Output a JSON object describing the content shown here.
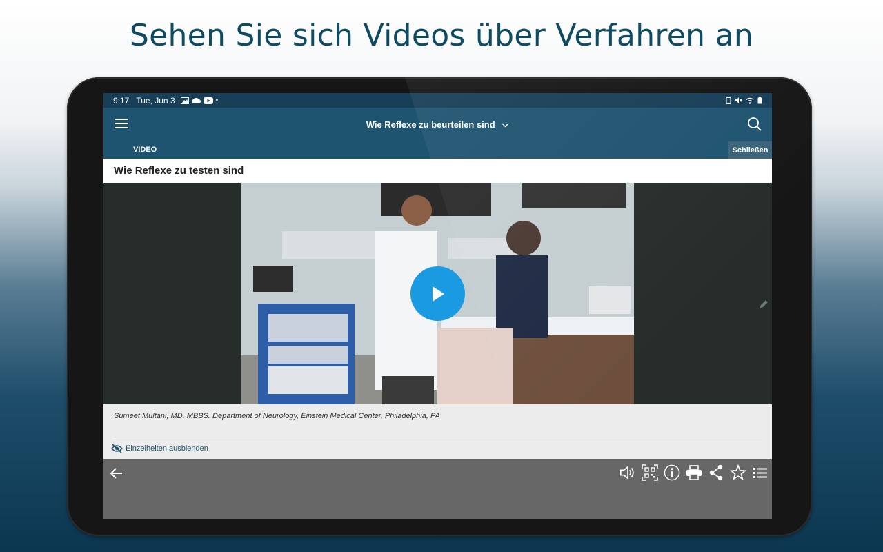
{
  "headline": "Sehen Sie sich Videos über Verfahren an",
  "status": {
    "time": "9:17",
    "date": "Tue, Jun 3"
  },
  "appbar": {
    "title": "Wie Reflexe zu beurteilen sind"
  },
  "subbar": {
    "label": "VIDEO",
    "close_label": "Schließen"
  },
  "video": {
    "title": "Wie Reflexe zu testen sind",
    "caption": "Sumeet Multani, MD, MBBS. Department of Neurology, Einstein Medical Center, Philadelphia, PA",
    "hide_details_label": "Einzelheiten ausblenden"
  },
  "icons": {
    "menu": "hamburger-icon",
    "search": "search-icon",
    "dropdown": "chevron-down-icon",
    "play": "play-icon",
    "back": "arrow-left-icon",
    "toolbar": [
      "speaker-icon",
      "qr-code-icon",
      "info-icon",
      "print-icon",
      "share-icon",
      "star-icon",
      "list-icon"
    ]
  },
  "colors": {
    "headline": "#0f4c63",
    "appbar": "#1f5470",
    "statusbar": "#173f57",
    "play_button": "#1a9ae0",
    "bottombar": "#676767"
  }
}
